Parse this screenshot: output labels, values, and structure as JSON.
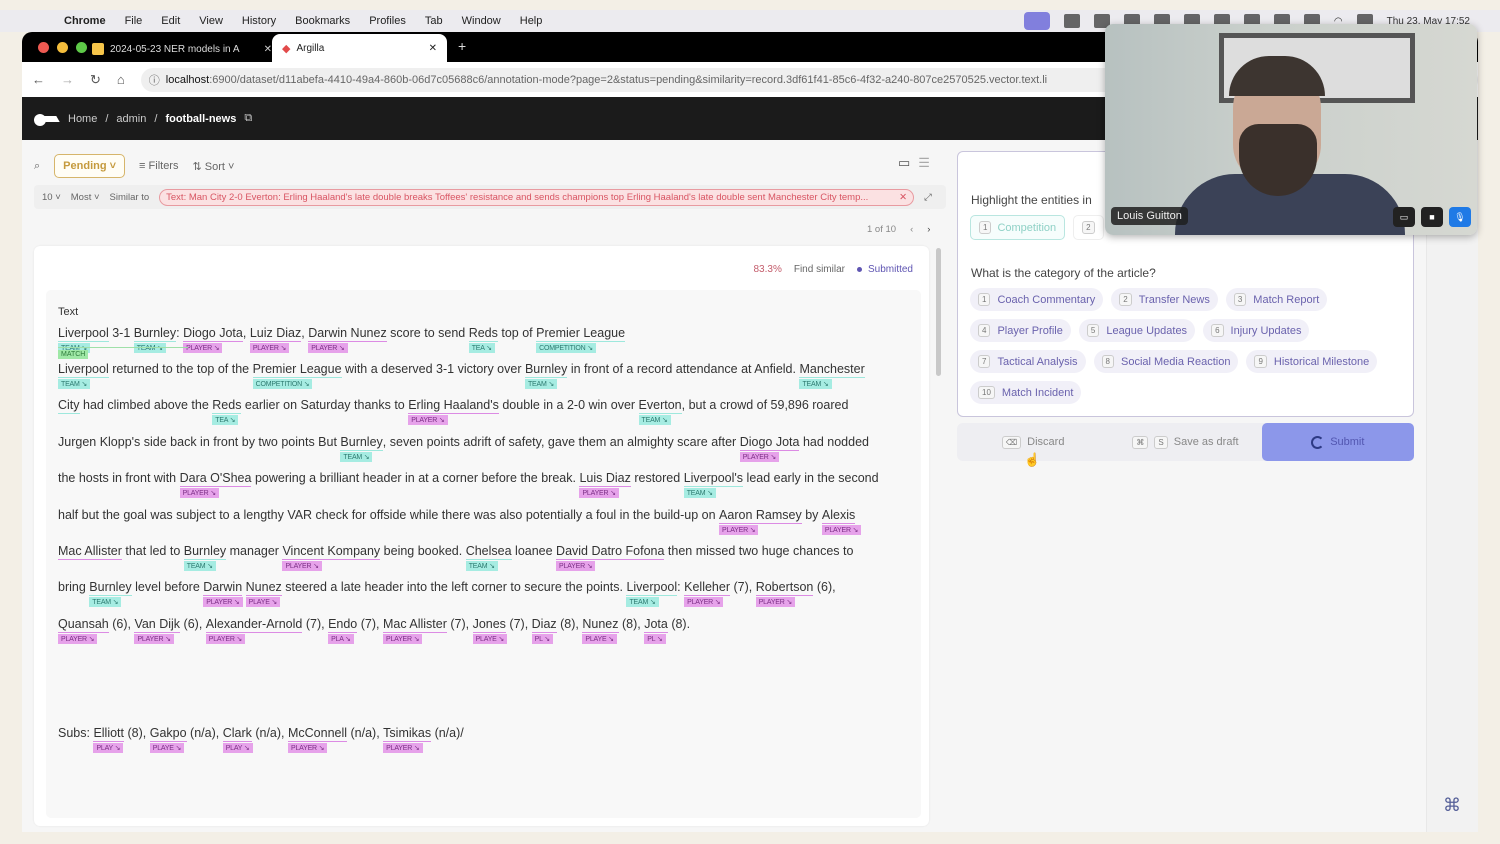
{
  "os_menu": {
    "app": "Chrome",
    "items": [
      "File",
      "Edit",
      "View",
      "History",
      "Bookmarks",
      "Profiles",
      "Tab",
      "Window",
      "Help"
    ],
    "clock": "Thu 23. May  17:52"
  },
  "browser": {
    "tabs": [
      {
        "title": "2024-05-23 NER models in A",
        "active": false
      },
      {
        "title": "Argilla",
        "active": true
      }
    ],
    "url_host": "localhost",
    "url_rest": ":6900/dataset/d11abefa-4410-49a4-860b-06d7c05688c6/annotation-mode?page=2&status=pending&similarity=record.3df61f41-85c6-4f32-a240-807ce2570525.vector.text.li"
  },
  "breadcrumb": {
    "home": "Home",
    "sep": "/",
    "user": "admin",
    "dataset": "football-news"
  },
  "toolbar": {
    "status": "Pending",
    "filters": "Filters",
    "sort": "Sort"
  },
  "similarity": {
    "count": "10",
    "order": "Most",
    "label": "Similar to",
    "query": "Text: Man City 2-0 Everton: Erling Haaland's late double breaks Toffees' resistance and sends champions top Erling Haaland's late double sent Manchester City temp..."
  },
  "pager": {
    "text": "1 of 10"
  },
  "record": {
    "similarity_score": "83.3%",
    "find_similar": "Find similar",
    "status": "Submitted",
    "field_label": "Text",
    "lines": [
      "Liverpool 3-1 Burnley: Diogo Jota, Luiz Diaz, Darwin Nunez score to send Reds top of Premier League",
      "Liverpool returned to the top of the Premier League with a deserved 3-1 victory over Burnley in front of a record attendance at Anfield. Manchester",
      "City had climbed above the Reds earlier on Saturday thanks to Erling Haaland's double in a 2-0 win over Everton, but a crowd of 59,896 roared",
      "Jurgen Klopp's side back in front by two points But Burnley, seven points adrift of safety, gave them an almighty scare after Diogo Jota had nodded",
      "the hosts in front with Dara O'Shea powering a brilliant header in at a corner before the break. Luis Diaz restored Liverpool's lead early in the second",
      "half but the goal was subject to a lengthy VAR check for offside while there was also potentially a foul in the build-up on Aaron Ramsey by Alexis",
      "Mac Allister that led to Burnley manager Vincent Kompany being booked. Chelsea loanee David Datro Fofona then missed two huge chances to",
      "bring Burnley level before Darwin Nunez steered a late header into the left corner to secure the points. Liverpool: Kelleher (7), Robertson (6),",
      "Quansah (6), Van Dijk (6), Alexander-Arnold (7), Endo (7), Mac Allister (7), Jones (7), Diaz (8), Nunez (8), Jota (8).",
      "Subs:  Elliott (8), Gakpo (n/a), Clark (n/a), McConnell (n/a), Tsimikas (n/a)/"
    ],
    "entity_labels": {
      "team": "TEAM",
      "player": "PLAYER",
      "competition": "COMPETITION",
      "match": "MATCH"
    }
  },
  "questions": {
    "entities_title": "Highlight the entities in",
    "entity_options": [
      {
        "key": "1",
        "label": "Competition"
      },
      {
        "key": "2",
        "label": ""
      }
    ],
    "category_title": "What is the category of the article?",
    "categories": [
      {
        "key": "1",
        "label": "Coach Commentary"
      },
      {
        "key": "2",
        "label": "Transfer News"
      },
      {
        "key": "3",
        "label": "Match Report"
      },
      {
        "key": "4",
        "label": "Player Profile"
      },
      {
        "key": "5",
        "label": "League Updates"
      },
      {
        "key": "6",
        "label": "Injury Updates"
      },
      {
        "key": "7",
        "label": "Tactical Analysis"
      },
      {
        "key": "8",
        "label": "Social Media Reaction"
      },
      {
        "key": "9",
        "label": "Historical Milestone"
      },
      {
        "key": "10",
        "label": "Match Incident"
      }
    ]
  },
  "actions": {
    "discard": "Discard",
    "save_keys": [
      "⌘",
      "S"
    ],
    "save": "Save as draft",
    "submit": "Submit"
  },
  "video": {
    "participant": "Louis Guitton"
  },
  "colors": {
    "team": "#a6ece2",
    "player": "#e6a2ea",
    "match": "#9fe8a6",
    "submit": "#8c97ea",
    "pending": "#c59a3d"
  }
}
